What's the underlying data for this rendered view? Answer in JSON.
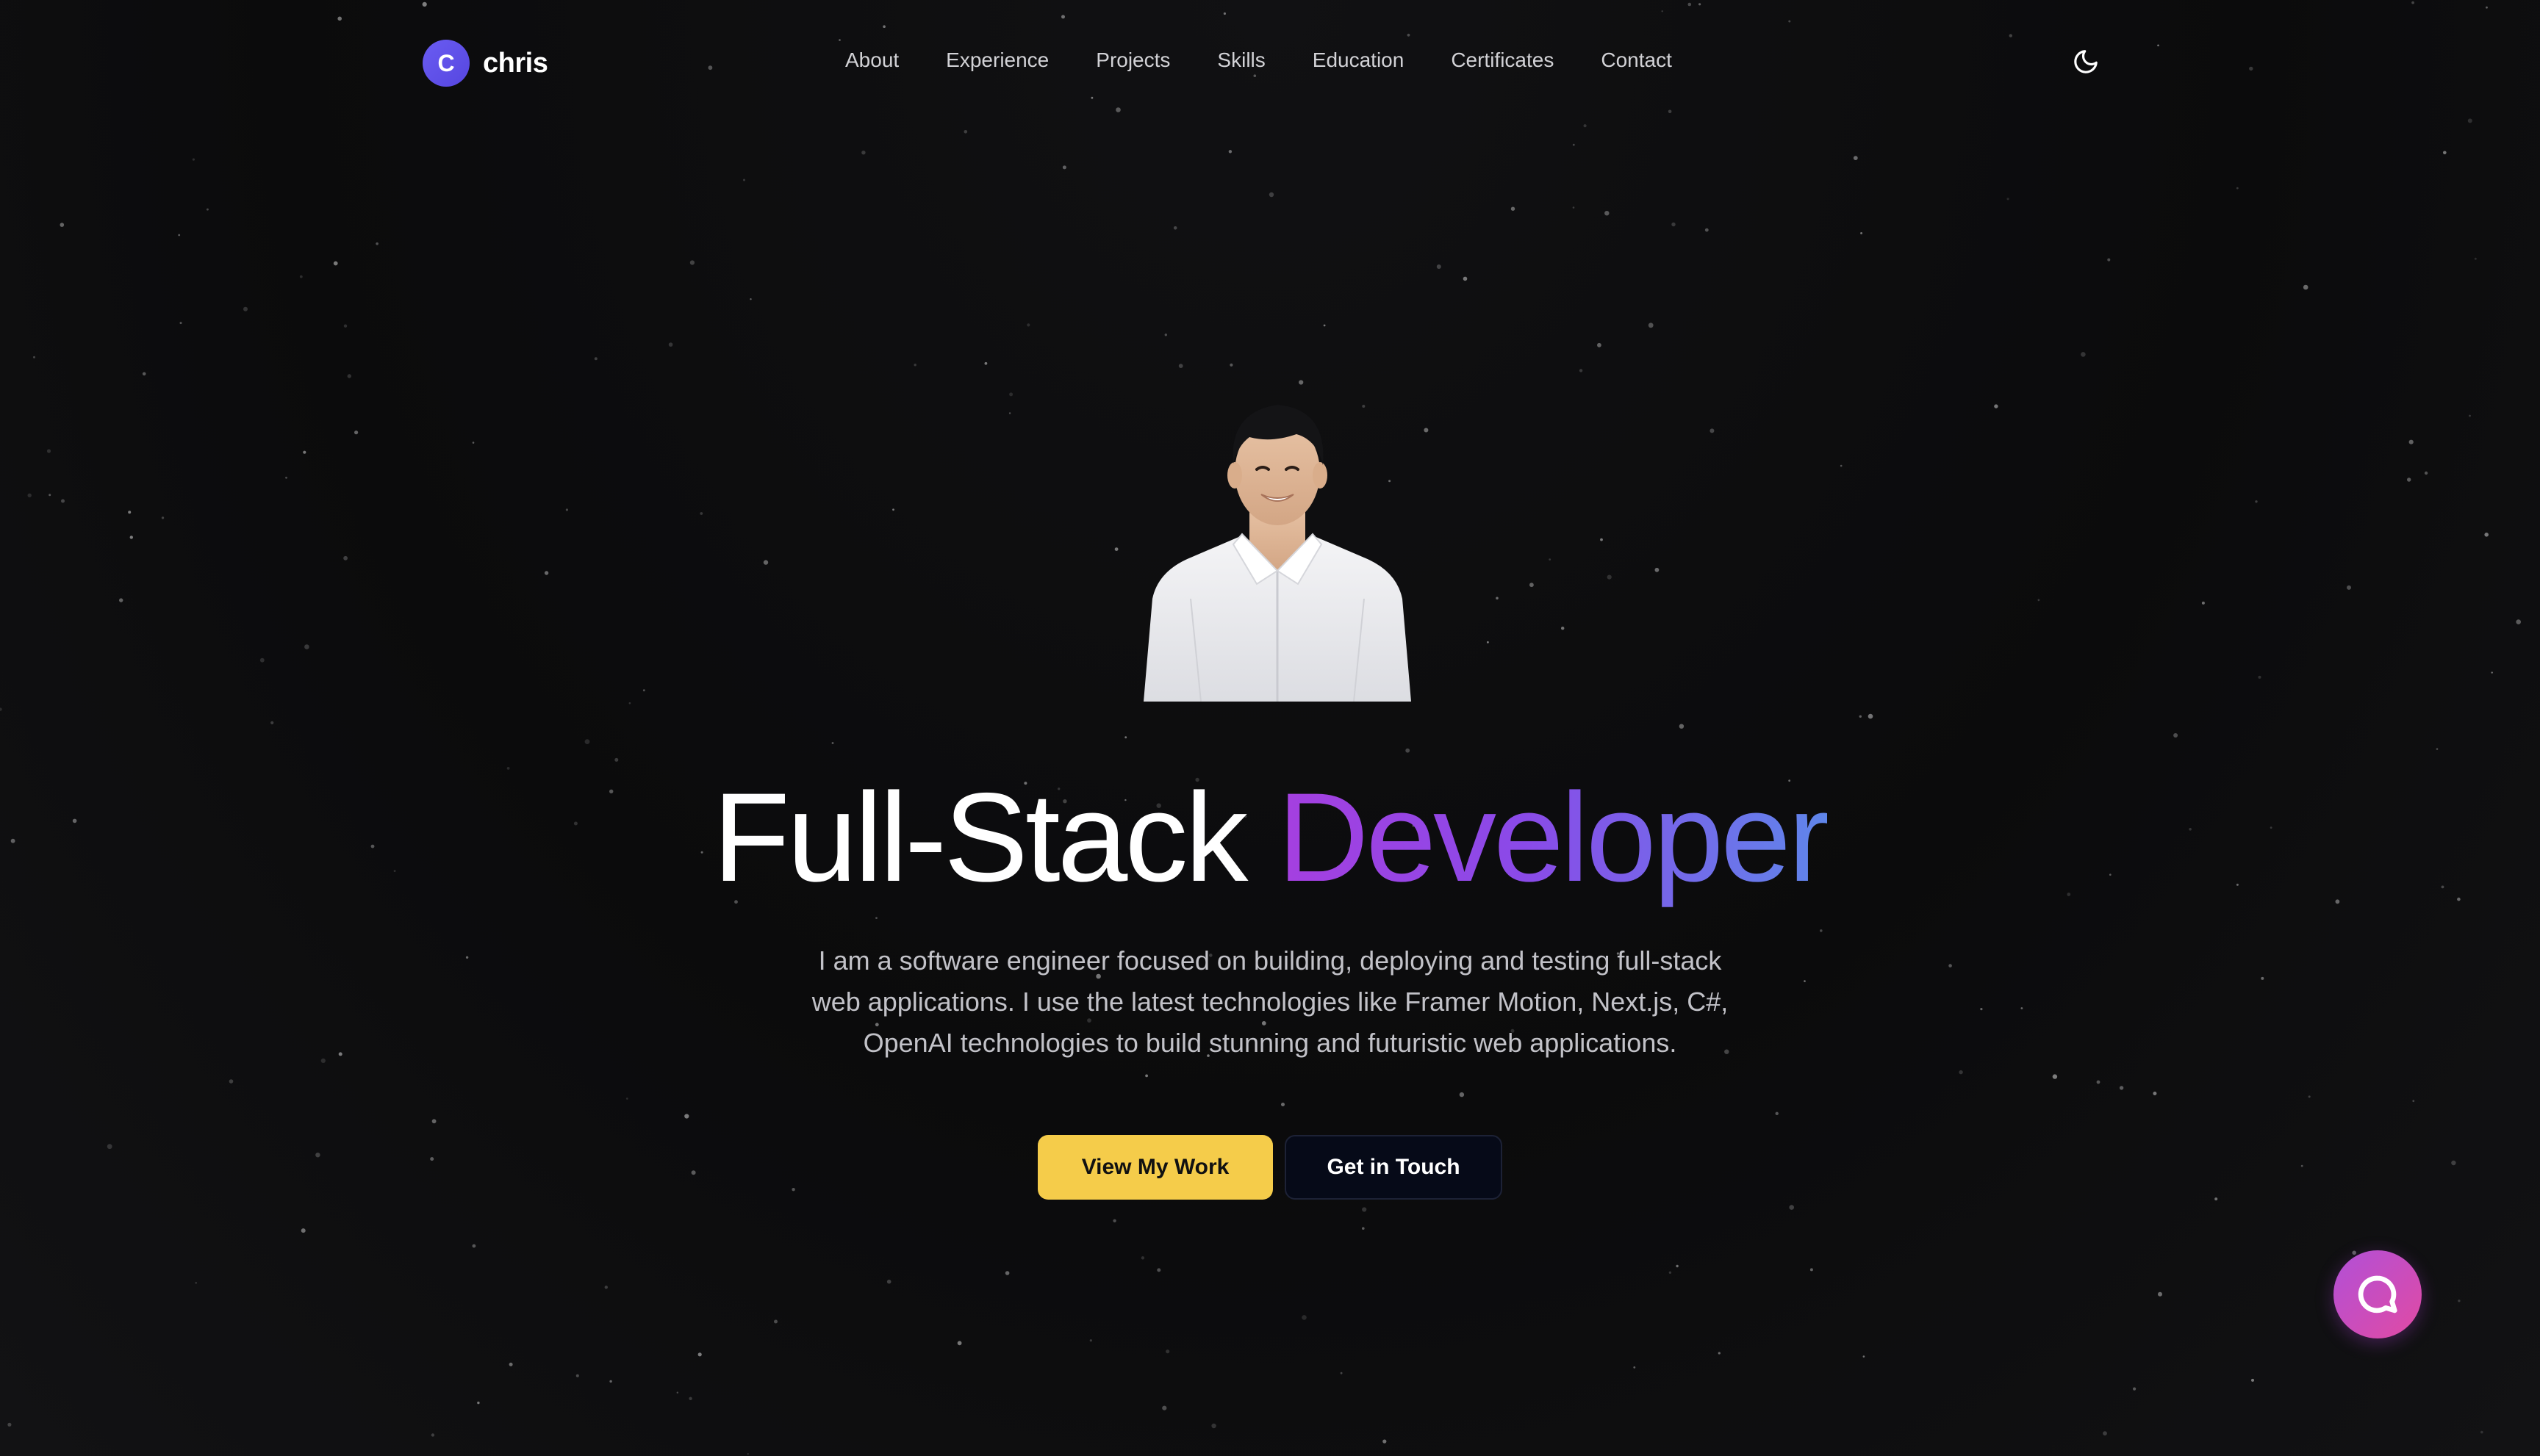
{
  "brand": {
    "initial": "C",
    "name": "chris",
    "badge_color": "#5f50ea"
  },
  "nav": {
    "items": [
      {
        "label": "About"
      },
      {
        "label": "Experience"
      },
      {
        "label": "Projects"
      },
      {
        "label": "Skills"
      },
      {
        "label": "Education"
      },
      {
        "label": "Certificates"
      },
      {
        "label": "Contact"
      }
    ],
    "theme_toggle_icon": "moon-icon"
  },
  "hero": {
    "portrait_icon": "profile-photo",
    "title_plain": "Full-Stack",
    "title_highlight": "Developer",
    "intro": "I am a software engineer focused on building, deploying and testing full-stack web applications. I use the latest technologies like Framer Motion, Next.js, C#, OpenAI technologies to build stunning and futuristic web applications.",
    "primary_button": "View My Work",
    "secondary_button": "Get in Touch",
    "primary_color": "#f5cc4a",
    "highlight_gradient": [
      "#a53fe0",
      "#5f86ea"
    ]
  },
  "chat": {
    "icon": "chat-bubble-icon",
    "color": "#c94cc0"
  }
}
